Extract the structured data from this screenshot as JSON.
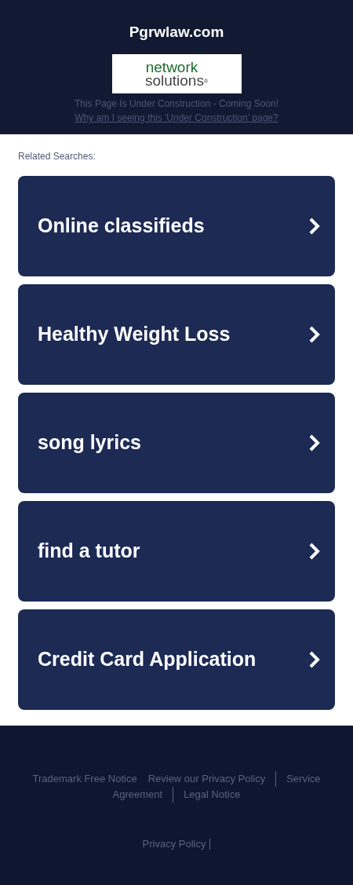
{
  "header": {
    "title": "Pgrwlaw.com",
    "logo": {
      "line_1": "network",
      "line_2": "solutions",
      "mark": "®"
    },
    "notice": "This Page Is Under Construction - Coming Soon!",
    "link": "Why am I seeing this 'Under Construction' page?"
  },
  "related": {
    "heading": "Related Searches:",
    "items": [
      {
        "label": "Online classifieds"
      },
      {
        "label": "Healthy Weight Loss"
      },
      {
        "label": "song lyrics"
      },
      {
        "label": "find a tutor"
      },
      {
        "label": "Credit Card Application"
      }
    ]
  },
  "footer": {
    "link_lines": [
      [
        {
          "label": "Trademark Free Notice",
          "separator": false
        },
        {
          "label": "Review our Privacy Policy",
          "separator": true
        },
        {
          "label": "Service",
          "separator": false
        }
      ],
      [
        {
          "label": "Agreement",
          "separator": true
        },
        {
          "label": "Legal Notice",
          "separator": false
        }
      ]
    ],
    "bottom_links": [
      {
        "label": "Privacy Policy",
        "separator": true
      }
    ]
  }
}
